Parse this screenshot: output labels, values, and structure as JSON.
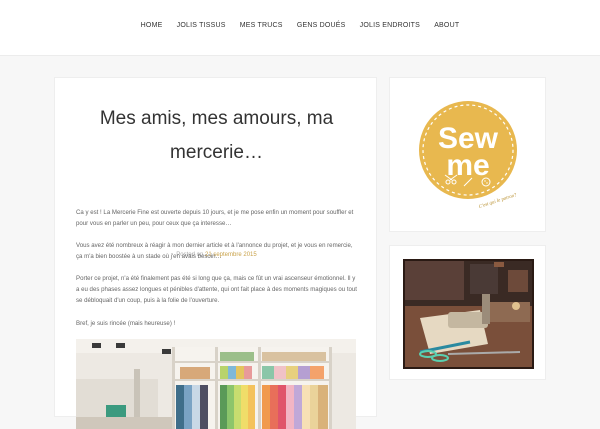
{
  "nav": {
    "items": [
      "HOME",
      "JOLIS TISSUS",
      "MES TRUCS",
      "GENS DOUÉS",
      "JOLIS ENDROITS",
      "ABOUT"
    ]
  },
  "post": {
    "title_line1": "Mes amis, mes amours, ma",
    "title_line2": "mercerie…",
    "posted_on": "Posted on",
    "date": "21 septembre 2015",
    "paragraphs": [
      "Ca y est ! La Mercerie Fine est ouverte depuis 10 jours, et je me pose enfin un moment pour souffler et pour vous en parler un peu, pour ceux que ça interesse…",
      "Vous avez été nombreux à réagir à mon dernier article et à l'annonce du projet, et je vous en remercie, ça m'a bien boostée à un stade où j'en avais besoin…",
      "Porter ce projet, n'a été finalement pas été si long que ça, mais ce fût un vrai ascenseur émotionnel. Il y a eu des phases assez longues et pénibles d'attente, qui ont fait place à des moments magiques ou tout se débloquait d'un coup, puis à la folie de l'ouverture.",
      "Bref, je suis rincée (mais heureuse) !"
    ]
  },
  "sidebar": {
    "logo_line1": "Sew",
    "logo_line2": "me",
    "logo_tagline": "C'est qui le patron?"
  },
  "colors": {
    "accent": "#e8b94a",
    "logo_bg": "#e8b84f",
    "date": "#c9a24a"
  }
}
